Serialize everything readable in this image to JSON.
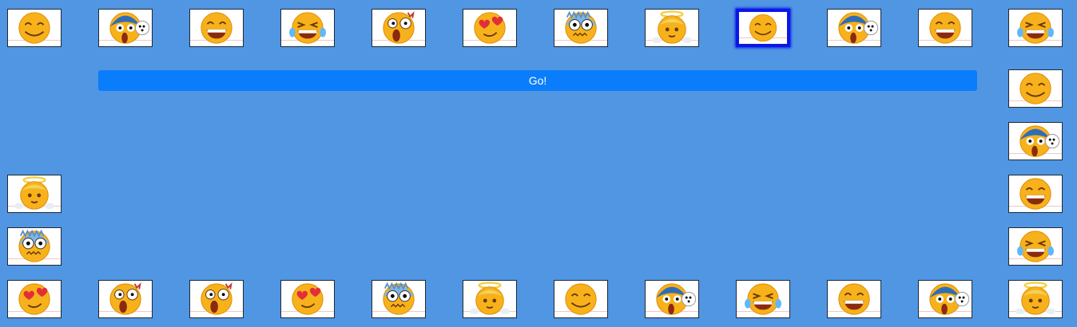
{
  "go_button": {
    "label": "Go!"
  },
  "emoji_kinds": {
    "smile": "smiling-face-icon",
    "grin": "grinning-face-icon",
    "joy": "tears-of-joy-face-icon",
    "shock": "shocked-face-icon",
    "love": "heart-eyes-face-icon",
    "fear": "fearful-face-icon",
    "angel": "angel-face-icon",
    "scream": "screaming-face-icon"
  },
  "colors": {
    "background": "#5096e3",
    "go_button": "#0a7dfa",
    "selection_border": "#0a18e6",
    "tile_face": "#f7b21b"
  },
  "tiles": [
    {
      "emoji": "smile",
      "selected": false
    },
    {
      "emoji": "scream",
      "selected": false
    },
    {
      "emoji": "grin",
      "selected": false
    },
    {
      "emoji": "joy",
      "selected": false
    },
    {
      "emoji": "shock",
      "selected": false
    },
    {
      "emoji": "love",
      "selected": false
    },
    {
      "emoji": "fear",
      "selected": false
    },
    {
      "emoji": "angel",
      "selected": false
    },
    {
      "emoji": "smile",
      "selected": true
    },
    {
      "emoji": "scream",
      "selected": false
    },
    {
      "emoji": "grin",
      "selected": false
    },
    {
      "emoji": "joy",
      "selected": false
    },
    {
      "emoji": "smile",
      "selected": false
    },
    {
      "emoji": "scream",
      "selected": false
    },
    {
      "emoji": "grin",
      "selected": false
    },
    {
      "emoji": "joy",
      "selected": false
    },
    {
      "emoji": "angel",
      "selected": false
    },
    {
      "emoji": "scream",
      "selected": false
    },
    {
      "emoji": "grin",
      "selected": false
    },
    {
      "emoji": "joy",
      "selected": false
    },
    {
      "emoji": "scream",
      "selected": false
    },
    {
      "emoji": "smile",
      "selected": false
    },
    {
      "emoji": "angel",
      "selected": false
    },
    {
      "emoji": "fear",
      "selected": false
    },
    {
      "emoji": "love",
      "selected": false
    },
    {
      "emoji": "shock",
      "selected": false
    },
    {
      "emoji": "shock",
      "selected": false
    },
    {
      "emoji": "love",
      "selected": false
    },
    {
      "emoji": "fear",
      "selected": false
    },
    {
      "emoji": "angel",
      "selected": false
    }
  ]
}
